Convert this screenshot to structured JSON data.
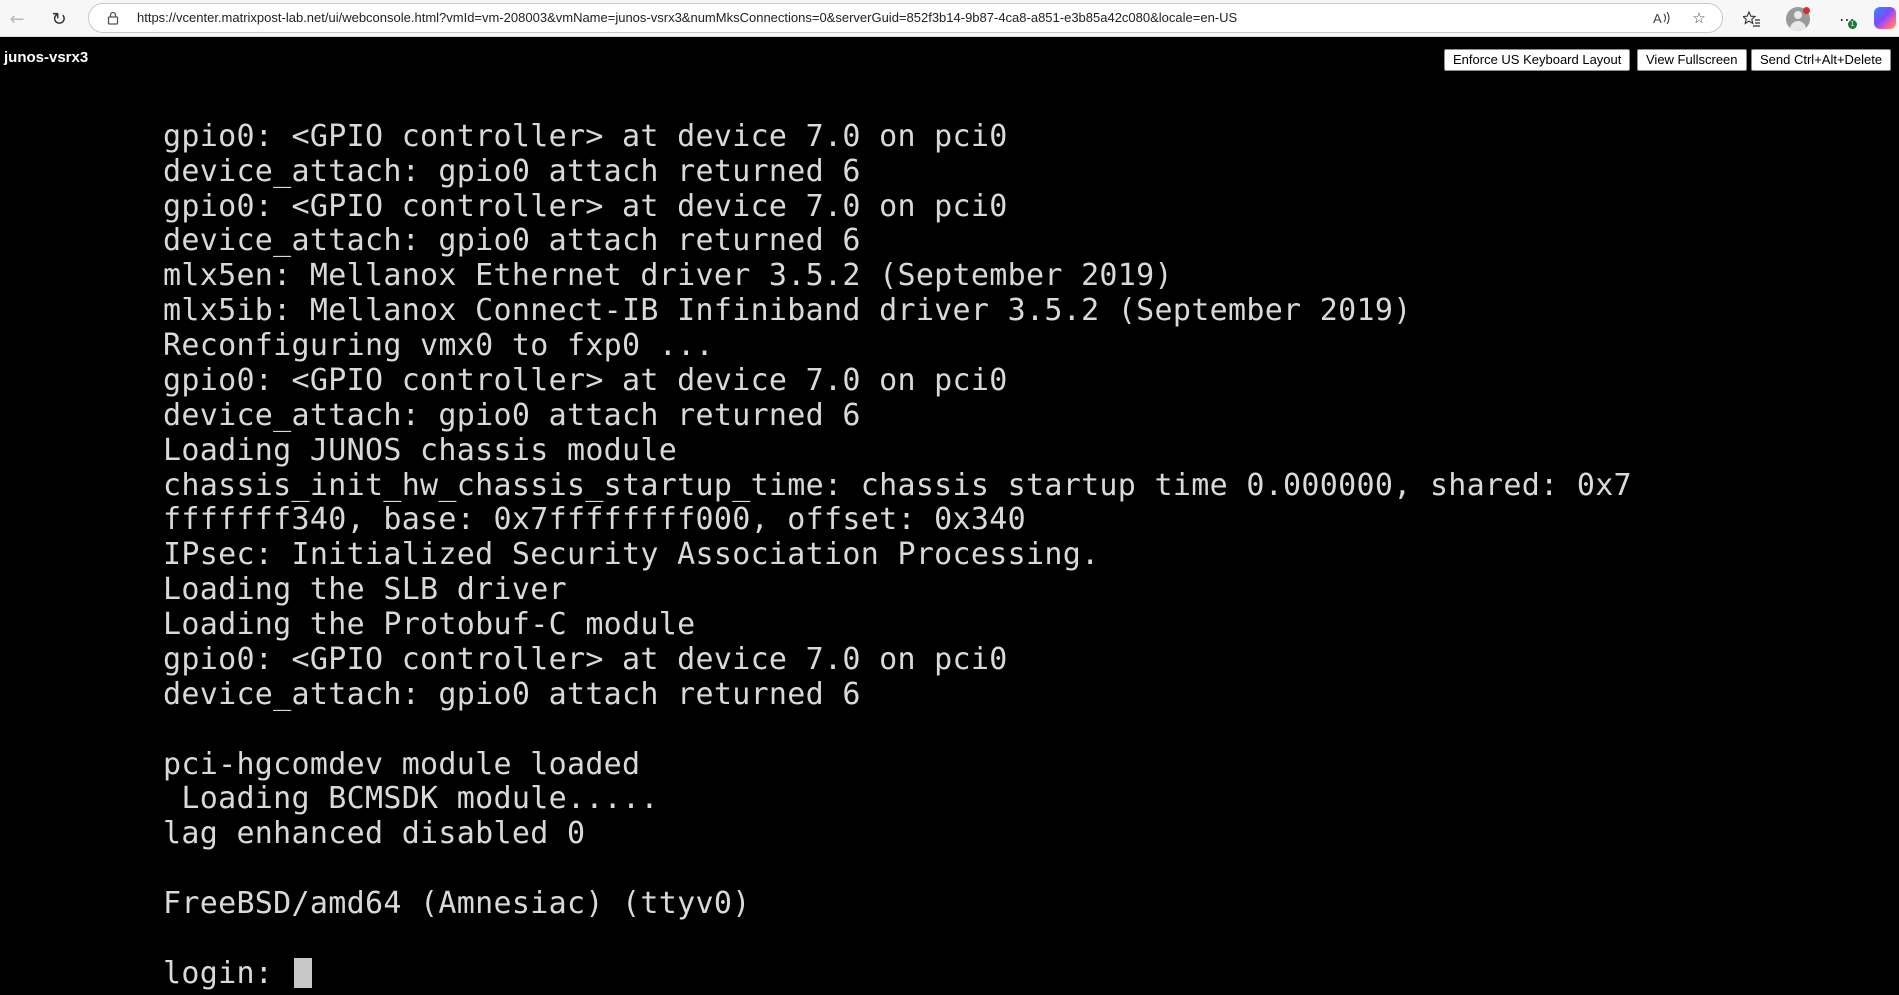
{
  "browser": {
    "back_icon": "arrow-left-icon",
    "refresh_icon": "refresh-icon",
    "url": "https://vcenter.matrixpost-lab.net/ui/webconsole.html?vmId=vm-208003&vmName=junos-vsrx3&numMksConnections=0&serverGuid=852f3b14-9b87-4ca8-a851-e3b85a42c080&locale=en-US",
    "ext_badge_count": "1"
  },
  "console": {
    "vm_name": "junos-vsrx3",
    "buttons": {
      "enforce_keyboard": "Enforce US Keyboard Layout",
      "view_fullscreen": "View Fullscreen",
      "send_cad": "Send Ctrl+Alt+Delete"
    }
  },
  "terminal": {
    "lines": [
      "gpio0: <GPIO controller> at device 7.0 on pci0",
      "device_attach: gpio0 attach returned 6",
      "gpio0: <GPIO controller> at device 7.0 on pci0",
      "device_attach: gpio0 attach returned 6",
      "mlx5en: Mellanox Ethernet driver 3.5.2 (September 2019)",
      "mlx5ib: Mellanox Connect-IB Infiniband driver 3.5.2 (September 2019)",
      "Reconfiguring vmx0 to fxp0 ...",
      "gpio0: <GPIO controller> at device 7.0 on pci0",
      "device_attach: gpio0 attach returned 6",
      "Loading JUNOS chassis module",
      "chassis_init_hw_chassis_startup_time: chassis startup time 0.000000, shared: 0x7",
      "fffffff340, base: 0x7ffffffff000, offset: 0x340",
      "IPsec: Initialized Security Association Processing.",
      "Loading the SLB driver",
      "Loading the Protobuf-C module",
      "gpio0: <GPIO controller> at device 7.0 on pci0",
      "device_attach: gpio0 attach returned 6",
      "",
      "pci-hgcomdev module loaded",
      " Loading BCMSDK module.....",
      "lag enhanced disabled 0",
      "",
      "FreeBSD/amd64 (Amnesiac) (ttyv0)",
      "",
      "login: "
    ]
  }
}
